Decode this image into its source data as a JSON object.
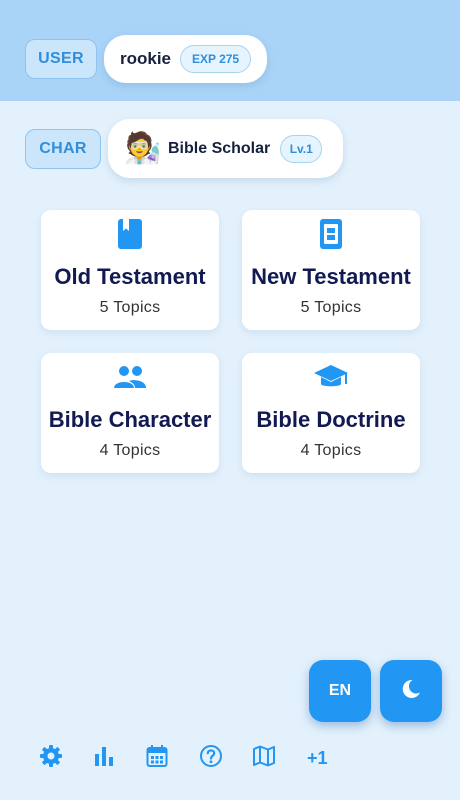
{
  "header": {
    "user_tag": "USER",
    "username": "rookie",
    "exp_badge": "EXP 275",
    "char_tag": "CHAR",
    "character_emoji": "🧑‍🔬",
    "character_name": "Bible Scholar",
    "level_badge": "Lv.1"
  },
  "categories": [
    {
      "title": "Old Testament",
      "subtitle": "5 Topics",
      "icon": "book-icon"
    },
    {
      "title": "New Testament",
      "subtitle": "5 Topics",
      "icon": "phone-book-icon"
    },
    {
      "title": "Bible Character",
      "subtitle": "4 Topics",
      "icon": "people-icon"
    },
    {
      "title": "Bible Doctrine",
      "subtitle": "4 Topics",
      "icon": "graduation-cap-icon"
    }
  ],
  "actions": {
    "language_label": "EN",
    "theme_icon": "moon-icon"
  },
  "bottom_nav": {
    "icons": [
      "gear-icon",
      "bar-chart-icon",
      "calendar-icon",
      "help-icon",
      "map-icon"
    ],
    "more_label": "+1"
  },
  "colors": {
    "accent": "#2196f3",
    "header_band": "#a9d3f7",
    "background": "#e3f1fc",
    "card_title": "#121a52"
  }
}
